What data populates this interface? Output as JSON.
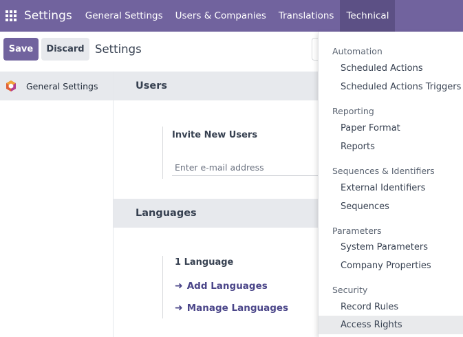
{
  "navbar": {
    "brand": "Settings",
    "menu": [
      "General Settings",
      "Users & Companies",
      "Translations",
      "Technical"
    ]
  },
  "control_panel": {
    "save_label": "Save",
    "discard_label": "Discard",
    "title": "Settings"
  },
  "sidebar": {
    "items": [
      {
        "label": "General Settings"
      }
    ]
  },
  "users_section": {
    "title": "Users",
    "invite_label": "Invite New Users",
    "email_placeholder": "Enter e-mail address"
  },
  "languages_section": {
    "title": "Languages",
    "count_text": "1 Language",
    "add_link": "Add Languages",
    "manage_link": "Manage Languages"
  },
  "technical_menu": {
    "groups": [
      {
        "header": "Automation",
        "items": [
          "Scheduled Actions",
          "Scheduled Actions Triggers"
        ]
      },
      {
        "header": "Reporting",
        "items": [
          "Paper Format",
          "Reports"
        ]
      },
      {
        "header": "Sequences & Identifiers",
        "items": [
          "External Identifiers",
          "Sequences"
        ]
      },
      {
        "header": "Parameters",
        "items": [
          "System Parameters",
          "Company Properties"
        ]
      },
      {
        "header": "Security",
        "items": [
          "Record Rules",
          "Access Rights"
        ]
      }
    ]
  },
  "colors": {
    "brand": "#71639e",
    "active_tab": "#5c5085",
    "link": "#4b4689",
    "section_bg": "#e7e9ed"
  }
}
